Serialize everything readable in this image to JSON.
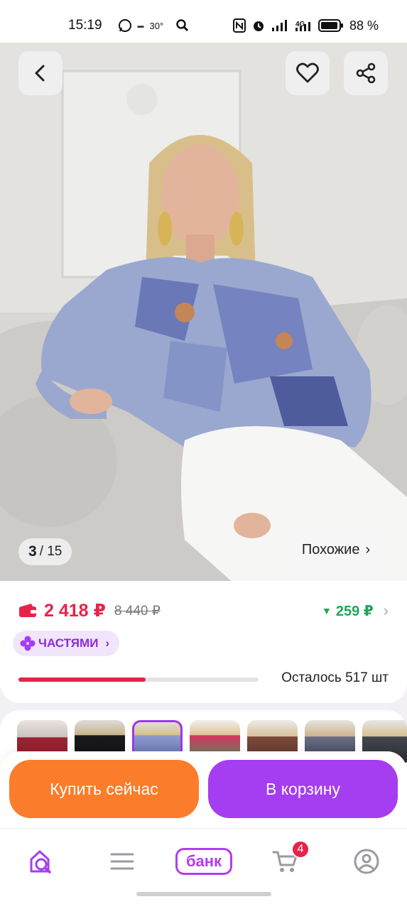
{
  "status_bar": {
    "time": "15:19",
    "temperature": "30°",
    "battery_percent": "88 %",
    "network": "4G"
  },
  "product_gallery": {
    "current_index": "3",
    "total_label": "/ 15",
    "similar_label": "Похожие"
  },
  "pricing": {
    "current_price": "2 418 ₽",
    "old_price": "8 440 ₽",
    "cashback": "259 ₽",
    "installment_label": "ЧАСТЯМИ",
    "stock_label": "Осталось 517 шт",
    "stock_fraction": 0.53
  },
  "actions": {
    "buy_now": "Купить сейчас",
    "add_to_cart": "В корзину"
  },
  "tabbar": {
    "bank_label": "банк",
    "cart_badge": "4"
  },
  "colors": {
    "accent_purple": "#a53df0",
    "buy_orange": "#fb7c2a",
    "price_red": "#e8234a",
    "cashback_green": "#1fa65a"
  },
  "icons": [
    "back-icon",
    "heart-icon",
    "share-icon",
    "wallet-icon",
    "installment-icon",
    "home-search-icon",
    "menu-icon",
    "cart-icon",
    "profile-icon"
  ]
}
